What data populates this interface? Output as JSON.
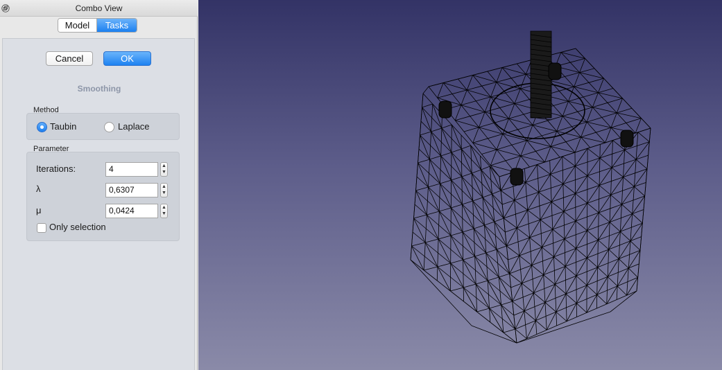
{
  "window": {
    "title": "Combo View"
  },
  "tabs": {
    "model": "Model",
    "tasks": "Tasks"
  },
  "buttons": {
    "cancel": "Cancel",
    "ok": "OK"
  },
  "section": {
    "title": "Smoothing"
  },
  "method": {
    "label": "Method",
    "options": [
      "Taubin",
      "Laplace"
    ],
    "selected": "Taubin"
  },
  "parameter": {
    "label": "Parameter",
    "iterations_label": "Iterations:",
    "iterations": "4",
    "lambda_label": "λ",
    "lambda": "0,6307",
    "mu_label": "μ",
    "mu": "0,0424",
    "only_selection_label": "Only selection",
    "only_selection": false
  },
  "colors": {
    "accent": "#1e82f1",
    "viewport_top": "#333366",
    "viewport_bottom": "#8a8aa8",
    "mesh_line": "#000000"
  }
}
